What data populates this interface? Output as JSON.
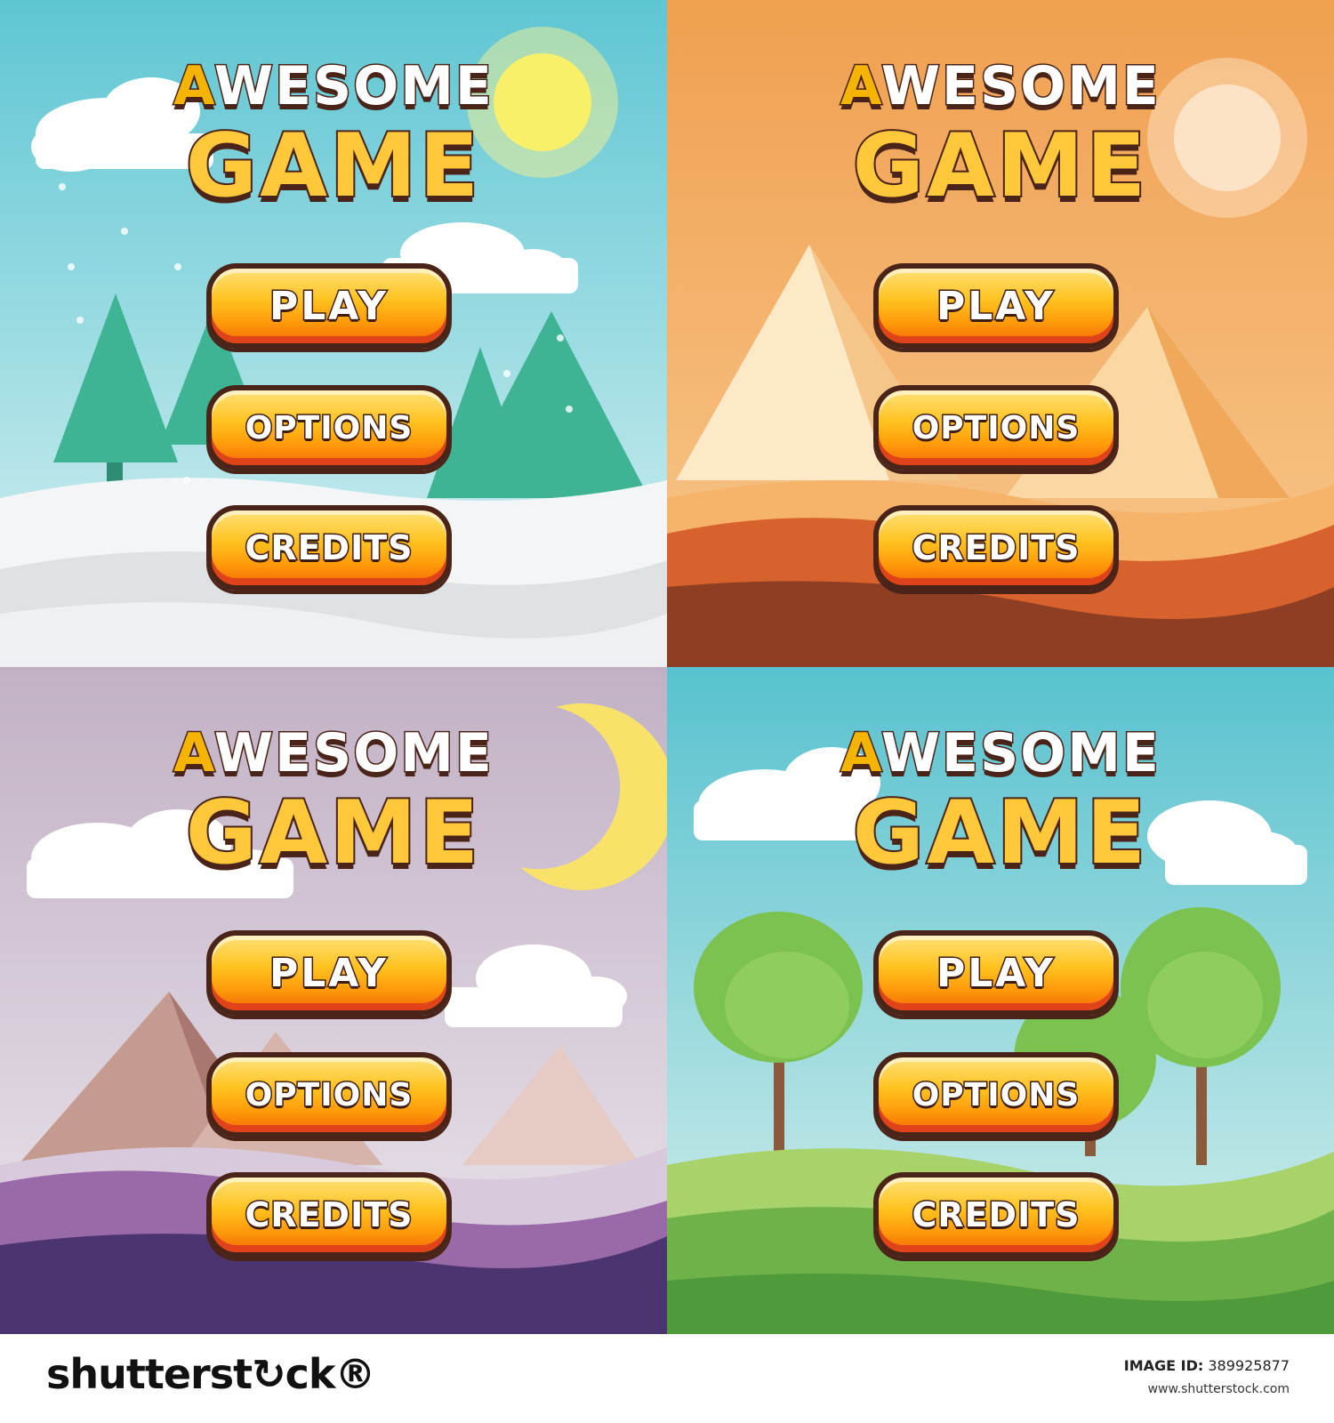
{
  "menu": {
    "title_line1_accent": "A",
    "title_line1_rest": "WESOME",
    "title_line2": "GAME",
    "buttons": {
      "play": "PLAY",
      "options": "OPTIONS",
      "credits": "CREDITS"
    }
  },
  "panels": [
    {
      "theme": "winter",
      "sky": "#9fdbe1"
    },
    {
      "theme": "desert",
      "sky": "#f4a55e"
    },
    {
      "theme": "night",
      "sky": "#c7b9c9"
    },
    {
      "theme": "meadow",
      "sky": "#8fd7e0"
    }
  ],
  "footer": {
    "brand": "shutterst↻ck®",
    "image_id_label": "IMAGE ID:",
    "image_id": "389925877",
    "site": "www.shutterstock.com"
  }
}
